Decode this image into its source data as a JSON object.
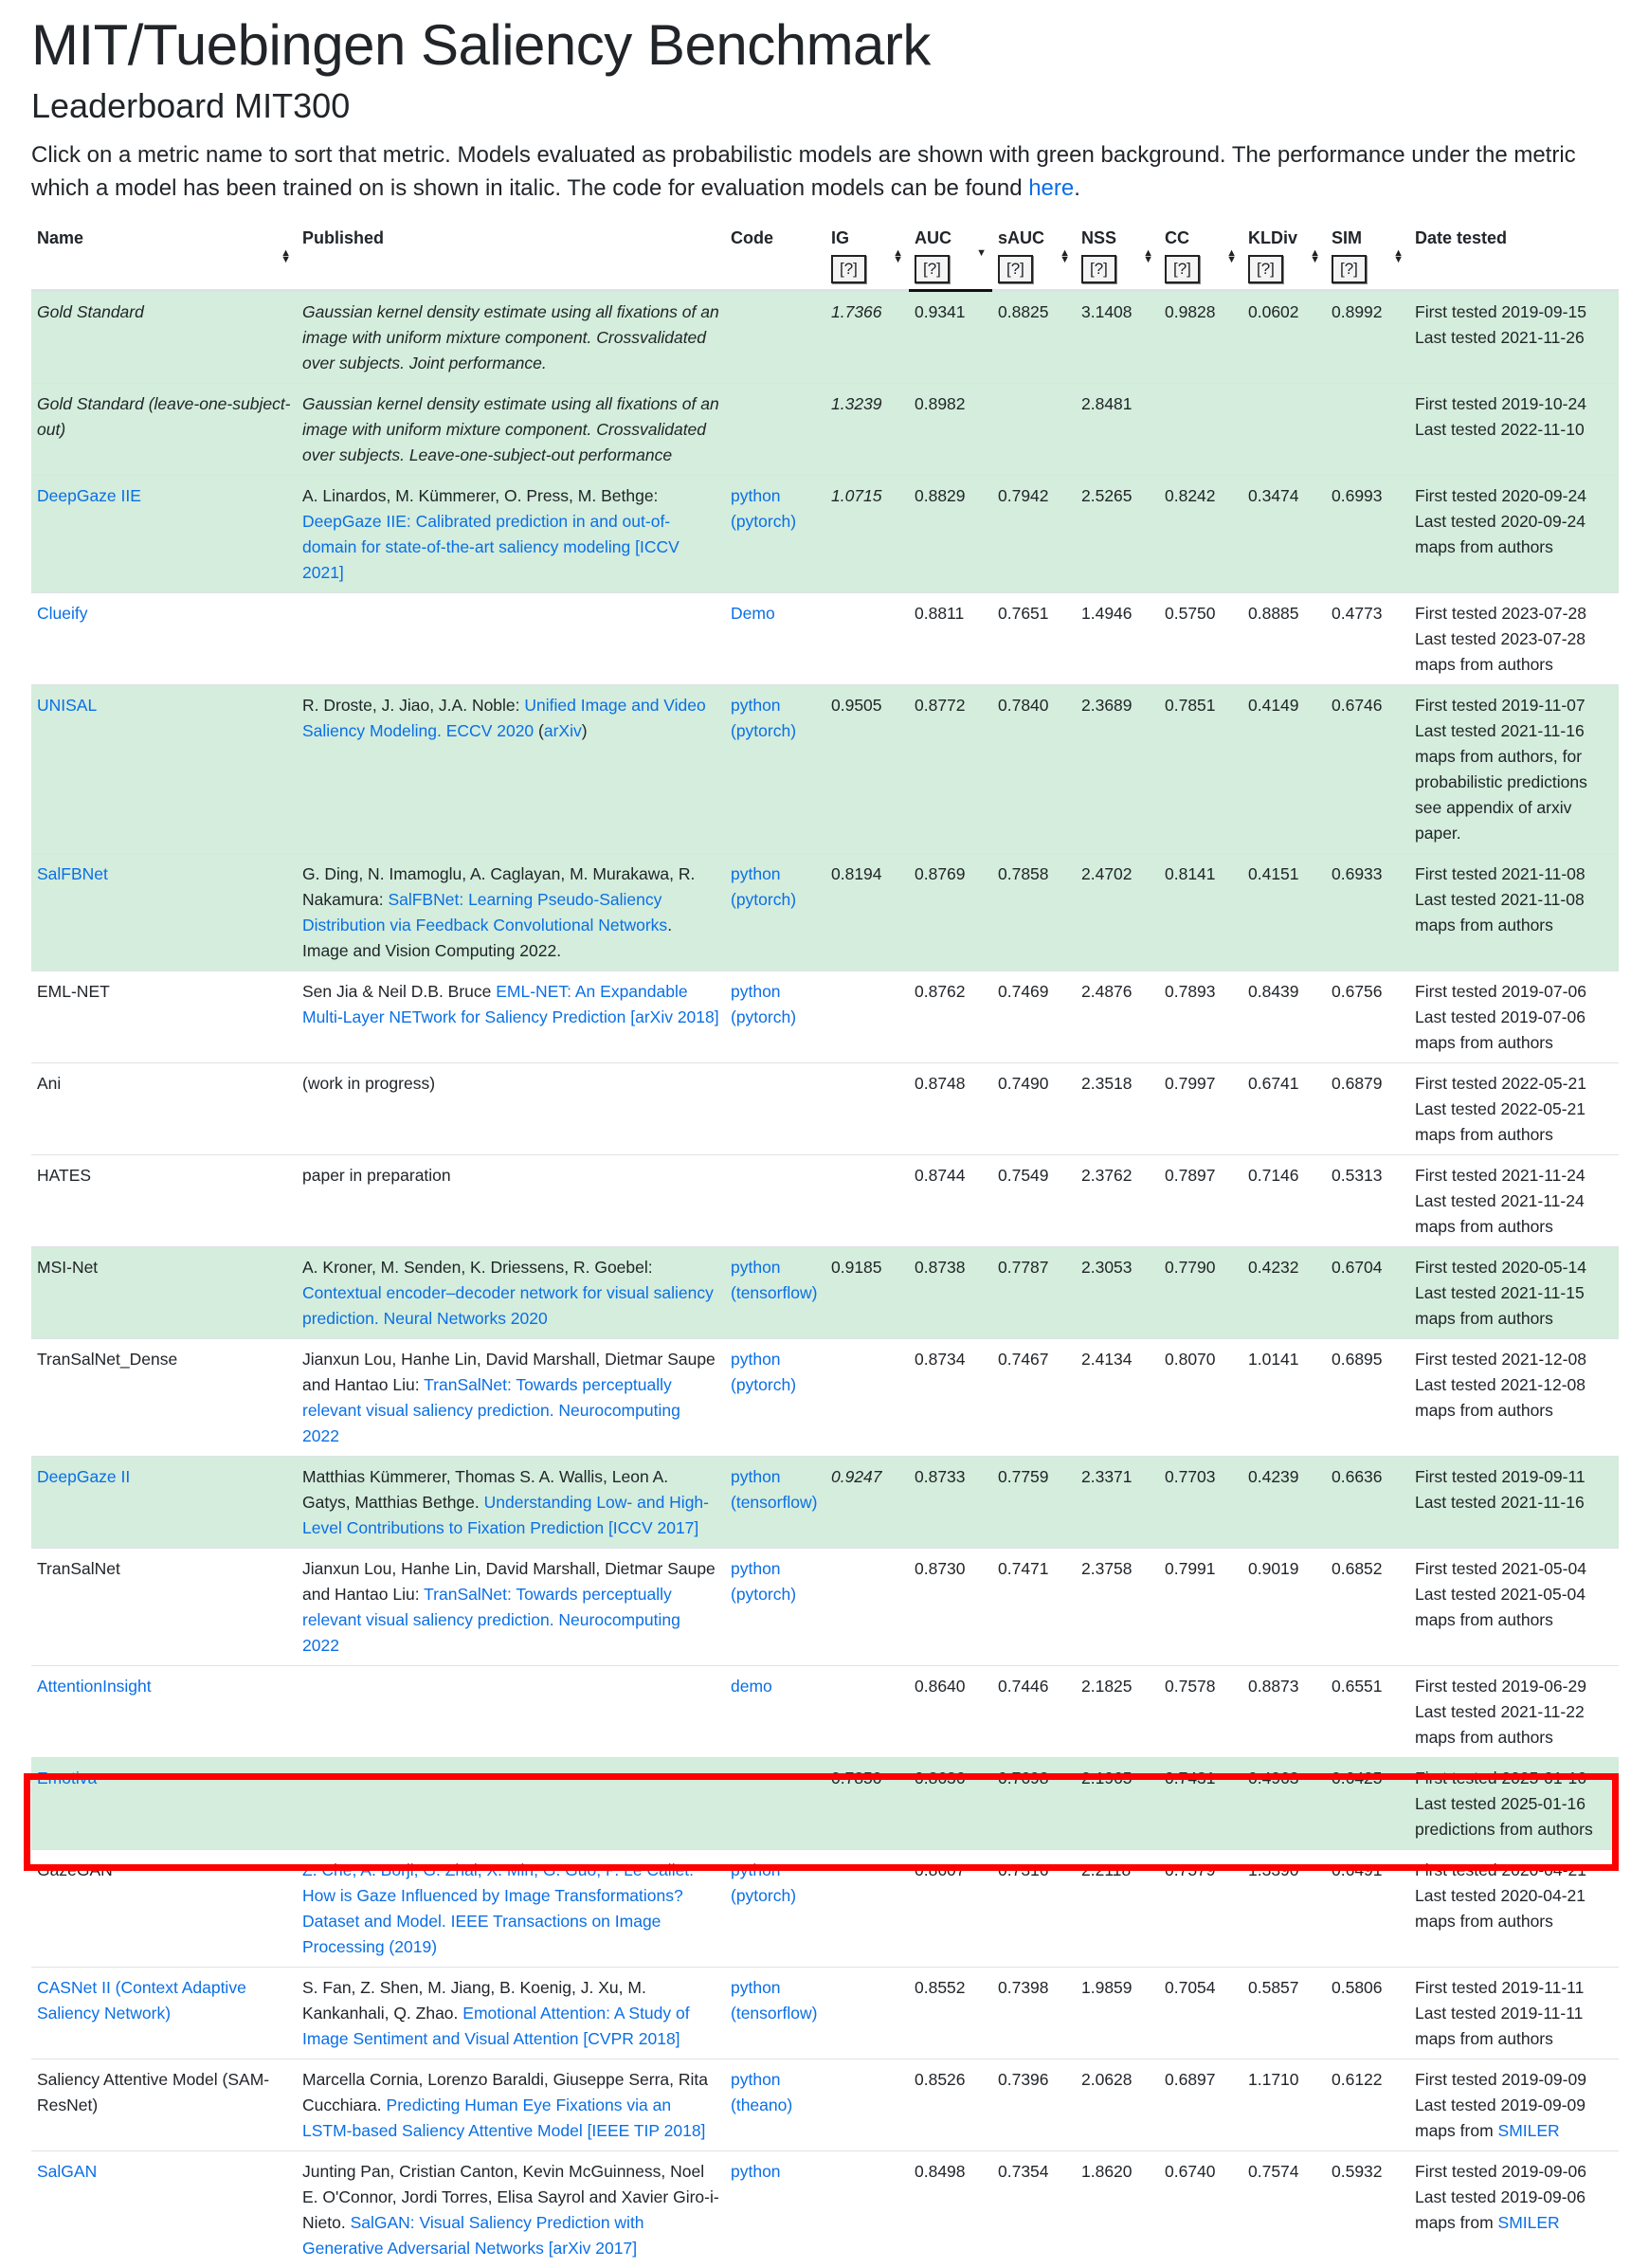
{
  "page": {
    "title": "MIT/Tuebingen Saliency Benchmark",
    "subtitle": "Leaderboard MIT300",
    "intro_text": "Click on a metric name to sort that metric. Models evaluated as probabilistic models are shown with green background. The performance under the metric which a model has been trained on is shown in italic. The code for evaluation models can be found ",
    "intro_link": "here",
    "intro_end": "."
  },
  "table": {
    "columns": [
      {
        "key": "name",
        "label": "Name",
        "help": "",
        "sort": "both"
      },
      {
        "key": "published",
        "label": "Published",
        "help": "",
        "sort": ""
      },
      {
        "key": "code",
        "label": "Code",
        "help": "",
        "sort": ""
      },
      {
        "key": "ig",
        "label": "IG",
        "help": "[?]",
        "sort": "both"
      },
      {
        "key": "auc",
        "label": "AUC",
        "help": "[?]",
        "sort": "down"
      },
      {
        "key": "sauc",
        "label": "sAUC",
        "help": "[?]",
        "sort": "both"
      },
      {
        "key": "nss",
        "label": "NSS",
        "help": "[?]",
        "sort": "both"
      },
      {
        "key": "cc",
        "label": "CC",
        "help": "[?]",
        "sort": "both"
      },
      {
        "key": "kldiv",
        "label": "KLDiv",
        "help": "[?]",
        "sort": "both"
      },
      {
        "key": "sim",
        "label": "SIM",
        "help": "[?]",
        "sort": "both"
      },
      {
        "key": "date",
        "label": "Date tested",
        "help": "",
        "sort": ""
      }
    ],
    "rows": [
      {
        "name": "Gold Standard",
        "name_link": false,
        "name_italic": true,
        "prob": true,
        "pub_plain": "Gaussian kernel density estimate using all fixations of an image with uniform mixture component. Crossvalidated over subjects. Joint performance.",
        "pub_link": "",
        "pub_after": "",
        "pub_italic": true,
        "code": [],
        "ig": "1.7366",
        "ig_italic": true,
        "auc": "0.9341",
        "sauc": "0.8825",
        "nss": "3.1408",
        "cc": "0.9828",
        "kldiv": "0.0602",
        "sim": "0.8992",
        "date": [
          "First tested 2019-09-15",
          "Last tested 2021-11-26"
        ],
        "date_link": ""
      },
      {
        "name": "Gold Standard (leave-one-subject-out)",
        "name_link": false,
        "name_italic": true,
        "prob": true,
        "pub_plain": "Gaussian kernel density estimate using all fixations of an image with uniform mixture component. Crossvalidated over subjects. Leave-one-subject-out performance",
        "pub_link": "",
        "pub_after": "",
        "pub_italic": true,
        "code": [],
        "ig": "1.3239",
        "ig_italic": true,
        "auc": "0.8982",
        "sauc": "",
        "nss": "2.8481",
        "cc": "",
        "kldiv": "",
        "sim": "",
        "date": [
          "First tested 2019-10-24",
          "Last tested 2022-11-10"
        ],
        "date_link": ""
      },
      {
        "name": "DeepGaze IIE",
        "name_link": true,
        "name_italic": false,
        "prob": true,
        "pub_plain": "A. Linardos, M. Kümmerer, O. Press, M. Bethge: ",
        "pub_link": "DeepGaze IIE: Calibrated prediction in and out-of-domain for state-of-the-art saliency modeling [ICCV 2021]",
        "pub_after": "",
        "pub_italic": false,
        "code": [
          "python",
          "(pytorch)"
        ],
        "ig": "1.0715",
        "ig_italic": true,
        "auc": "0.8829",
        "sauc": "0.7942",
        "nss": "2.5265",
        "cc": "0.8242",
        "kldiv": "0.3474",
        "sim": "0.6993",
        "date": [
          "First tested 2020-09-24",
          "Last tested 2020-09-24",
          "maps from authors"
        ],
        "date_link": ""
      },
      {
        "name": "Clueify",
        "name_link": true,
        "name_italic": false,
        "prob": false,
        "pub_plain": "",
        "pub_link": "",
        "pub_after": "",
        "pub_italic": false,
        "code": [
          "Demo"
        ],
        "ig": "",
        "ig_italic": false,
        "auc": "0.8811",
        "sauc": "0.7651",
        "nss": "1.4946",
        "cc": "0.5750",
        "kldiv": "0.8885",
        "sim": "0.4773",
        "date": [
          "First tested 2023-07-28",
          "Last tested 2023-07-28",
          "maps from authors"
        ],
        "date_link": ""
      },
      {
        "name": "UNISAL",
        "name_link": true,
        "name_italic": false,
        "prob": true,
        "pub_plain": "R. Droste, J. Jiao, J.A. Noble: ",
        "pub_link": "Unified Image and Video Saliency Modeling. ECCV 2020",
        "pub_after": " (",
        "pub_link2": "arXiv",
        "pub_after2": ")",
        "pub_italic": false,
        "code": [
          "python",
          "(pytorch)"
        ],
        "ig": "0.9505",
        "ig_italic": false,
        "auc": "0.8772",
        "sauc": "0.7840",
        "nss": "2.3689",
        "cc": "0.7851",
        "kldiv": "0.4149",
        "sim": "0.6746",
        "date": [
          "First tested 2019-11-07",
          "Last tested 2021-11-16",
          "maps from authors, for probabilistic predictions see appendix of arxiv paper."
        ],
        "date_link": ""
      },
      {
        "name": "SalFBNet",
        "name_link": true,
        "name_italic": false,
        "prob": true,
        "pub_plain": "G. Ding, N. Imamoglu, A. Caglayan, M. Murakawa, R. Nakamura: ",
        "pub_link": "SalFBNet: Learning Pseudo-Saliency Distribution via Feedback Convolutional Networks",
        "pub_after": ". Image and Vision Computing 2022.",
        "pub_italic": false,
        "code": [
          "python",
          "(pytorch)"
        ],
        "ig": "0.8194",
        "ig_italic": false,
        "auc": "0.8769",
        "sauc": "0.7858",
        "nss": "2.4702",
        "cc": "0.8141",
        "kldiv": "0.4151",
        "sim": "0.6933",
        "date": [
          "First tested 2021-11-08",
          "Last tested 2021-11-08",
          "maps from authors"
        ],
        "date_link": ""
      },
      {
        "name": "EML-NET",
        "name_link": false,
        "name_italic": false,
        "prob": false,
        "pub_plain": "Sen Jia & Neil D.B. Bruce ",
        "pub_link": "EML-NET: An Expandable Multi-Layer NETwork for Saliency Prediction [arXiv 2018]",
        "pub_after": "",
        "pub_italic": false,
        "code": [
          "python",
          "(pytorch)"
        ],
        "ig": "",
        "ig_italic": false,
        "auc": "0.8762",
        "sauc": "0.7469",
        "nss": "2.4876",
        "cc": "0.7893",
        "kldiv": "0.8439",
        "sim": "0.6756",
        "date": [
          "First tested 2019-07-06",
          "Last tested 2019-07-06",
          "maps from authors"
        ],
        "date_link": ""
      },
      {
        "name": "Ani",
        "name_link": false,
        "name_italic": false,
        "prob": false,
        "pub_plain": "(work in progress)",
        "pub_link": "",
        "pub_after": "",
        "pub_italic": false,
        "code": [],
        "ig": "",
        "ig_italic": false,
        "auc": "0.8748",
        "sauc": "0.7490",
        "nss": "2.3518",
        "cc": "0.7997",
        "kldiv": "0.6741",
        "sim": "0.6879",
        "date": [
          "First tested 2022-05-21",
          "Last tested 2022-05-21",
          "maps from authors"
        ],
        "date_link": ""
      },
      {
        "name": "HATES",
        "name_link": false,
        "name_italic": false,
        "prob": false,
        "pub_plain": "paper in preparation",
        "pub_link": "",
        "pub_after": "",
        "pub_italic": false,
        "code": [],
        "ig": "",
        "ig_italic": false,
        "auc": "0.8744",
        "sauc": "0.7549",
        "nss": "2.3762",
        "cc": "0.7897",
        "kldiv": "0.7146",
        "sim": "0.5313",
        "date": [
          "First tested 2021-11-24",
          "Last tested 2021-11-24",
          "maps from authors"
        ],
        "date_link": ""
      },
      {
        "name": "MSI-Net",
        "name_link": false,
        "name_italic": false,
        "prob": true,
        "pub_plain": "A. Kroner, M. Senden, K. Driessens, R. Goebel: ",
        "pub_link": "Contextual encoder–decoder network for visual saliency prediction. Neural Networks 2020",
        "pub_after": "",
        "pub_italic": false,
        "code": [
          "python",
          "(tensorflow)"
        ],
        "ig": "0.9185",
        "ig_italic": false,
        "auc": "0.8738",
        "sauc": "0.7787",
        "nss": "2.3053",
        "cc": "0.7790",
        "kldiv": "0.4232",
        "sim": "0.6704",
        "date": [
          "First tested 2020-05-14",
          "Last tested 2021-11-15",
          "maps from authors"
        ],
        "date_link": ""
      },
      {
        "name": "TranSalNet_Dense",
        "name_link": false,
        "name_italic": false,
        "prob": false,
        "pub_plain": "Jianxun Lou, Hanhe Lin, David Marshall, Dietmar Saupe and Hantao Liu: ",
        "pub_link": "TranSalNet: Towards perceptually relevant visual saliency prediction. Neurocomputing 2022",
        "pub_after": "",
        "pub_italic": false,
        "code": [
          "python",
          "(pytorch)"
        ],
        "ig": "",
        "ig_italic": false,
        "auc": "0.8734",
        "sauc": "0.7467",
        "nss": "2.4134",
        "cc": "0.8070",
        "kldiv": "1.0141",
        "sim": "0.6895",
        "date": [
          "First tested 2021-12-08",
          "Last tested 2021-12-08",
          "maps from authors"
        ],
        "date_link": ""
      },
      {
        "name": "DeepGaze II",
        "name_link": true,
        "name_italic": false,
        "prob": true,
        "pub_plain": "Matthias Kümmerer, Thomas S. A. Wallis, Leon A. Gatys, Matthias Bethge. ",
        "pub_link": "Understanding Low- and High-Level Contributions to Fixation Prediction [ICCV 2017]",
        "pub_after": "",
        "pub_italic": false,
        "code": [
          "python",
          "(tensorflow)"
        ],
        "ig": "0.9247",
        "ig_italic": true,
        "auc": "0.8733",
        "sauc": "0.7759",
        "nss": "2.3371",
        "cc": "0.7703",
        "kldiv": "0.4239",
        "sim": "0.6636",
        "date": [
          "First tested 2019-09-11",
          "Last tested 2021-11-16"
        ],
        "date_link": ""
      },
      {
        "name": "TranSalNet",
        "name_link": false,
        "name_italic": false,
        "prob": false,
        "pub_plain": "Jianxun Lou, Hanhe Lin, David Marshall, Dietmar Saupe and Hantao Liu: ",
        "pub_link": "TranSalNet: Towards perceptually relevant visual saliency prediction. Neurocomputing 2022",
        "pub_after": "",
        "pub_italic": false,
        "code": [
          "python",
          "(pytorch)"
        ],
        "ig": "",
        "ig_italic": false,
        "auc": "0.8730",
        "sauc": "0.7471",
        "nss": "2.3758",
        "cc": "0.7991",
        "kldiv": "0.9019",
        "sim": "0.6852",
        "date": [
          "First tested 2021-05-04",
          "Last tested 2021-05-04",
          "maps from authors"
        ],
        "date_link": ""
      },
      {
        "name": "AttentionInsight",
        "name_link": true,
        "name_italic": false,
        "prob": false,
        "pub_plain": "",
        "pub_link": "",
        "pub_after": "",
        "pub_italic": false,
        "code": [
          "demo"
        ],
        "ig": "",
        "ig_italic": false,
        "auc": "0.8640",
        "sauc": "0.7446",
        "nss": "2.1825",
        "cc": "0.7578",
        "kldiv": "0.8873",
        "sim": "0.6551",
        "date": [
          "First tested 2019-06-29",
          "Last tested 2021-11-22",
          "maps from authors"
        ],
        "date_link": ""
      },
      {
        "name": "Emotiva",
        "name_link": true,
        "name_italic": false,
        "prob": true,
        "highlight": true,
        "pub_plain": "",
        "pub_link": "",
        "pub_after": "",
        "pub_italic": false,
        "code": [],
        "ig": "0.7850",
        "ig_italic": false,
        "auc": "0.8636",
        "sauc": "0.7698",
        "nss": "2.1965",
        "cc": "0.7431",
        "kldiv": "0.4963",
        "sim": "0.6425",
        "date": [
          "First tested 2025-01-16",
          "Last tested 2025-01-16",
          "predictions from authors"
        ],
        "date_link": ""
      },
      {
        "name": "GazeGAN",
        "name_link": false,
        "name_italic": false,
        "prob": false,
        "pub_plain": "",
        "pub_link": "Z. Che, A. Borji, G. Zhai, X. Min, G. Guo, P. Le Callet: How is Gaze Influenced by Image Transformations? Dataset and Model. IEEE Transactions on Image Processing (2019)",
        "pub_after": "",
        "pub_italic": false,
        "code": [
          "python",
          "(pytorch)"
        ],
        "ig": "",
        "ig_italic": false,
        "auc": "0.8607",
        "sauc": "0.7316",
        "nss": "2.2118",
        "cc": "0.7579",
        "kldiv": "1.3390",
        "sim": "0.6491",
        "date": [
          "First tested 2020-04-21",
          "Last tested 2020-04-21",
          "maps from authors"
        ],
        "date_link": ""
      },
      {
        "name": "CASNet II (Context Adaptive Saliency Network)",
        "name_link": true,
        "name_italic": false,
        "prob": false,
        "pub_plain": "S. Fan, Z. Shen, M. Jiang, B. Koenig, J. Xu, M. Kankanhali, Q. Zhao. ",
        "pub_link": "Emotional Attention: A Study of Image Sentiment and Visual Attention [CVPR 2018]",
        "pub_after": "",
        "pub_italic": false,
        "code": [
          "python",
          "(tensorflow)"
        ],
        "ig": "",
        "ig_italic": false,
        "auc": "0.8552",
        "sauc": "0.7398",
        "nss": "1.9859",
        "cc": "0.7054",
        "kldiv": "0.5857",
        "sim": "0.5806",
        "date": [
          "First tested 2019-11-11",
          "Last tested 2019-11-11",
          "maps from authors"
        ],
        "date_link": ""
      },
      {
        "name": "Saliency Attentive Model (SAM-ResNet)",
        "name_link": false,
        "name_italic": false,
        "prob": false,
        "pub_plain": "Marcella Cornia, Lorenzo Baraldi, Giuseppe Serra, Rita Cucchiara. ",
        "pub_link": "Predicting Human Eye Fixations via an LSTM-based Saliency Attentive Model [IEEE TIP 2018]",
        "pub_after": "",
        "pub_italic": false,
        "code": [
          "python",
          "(theano)"
        ],
        "ig": "",
        "ig_italic": false,
        "auc": "0.8526",
        "sauc": "0.7396",
        "nss": "2.0628",
        "cc": "0.6897",
        "kldiv": "1.1710",
        "sim": "0.6122",
        "date": [
          "First tested 2019-09-09",
          "Last tested 2019-09-09",
          "maps from "
        ],
        "date_link": "SMILER"
      },
      {
        "name": "SalGAN",
        "name_link": true,
        "name_italic": false,
        "prob": false,
        "pub_plain": "Junting Pan, Cristian Canton, Kevin McGuinness, Noel E. O'Connor, Jordi Torres, Elisa Sayrol and Xavier Giro-i-Nieto. ",
        "pub_link": "SalGAN: Visual Saliency Prediction with Generative Adversarial Networks [arXiv 2017]",
        "pub_after": "",
        "pub_italic": false,
        "code": [
          "python"
        ],
        "ig": "",
        "ig_italic": false,
        "auc": "0.8498",
        "sauc": "0.7354",
        "nss": "1.8620",
        "cc": "0.6740",
        "kldiv": "0.7574",
        "sim": "0.5932",
        "date": [
          "First tested 2019-09-06",
          "Last tested 2019-09-06",
          "maps from "
        ],
        "date_link": "SMILER"
      }
    ]
  },
  "colors": {
    "probabilistic_bg": "#d4eddc",
    "link": "#0a6fe6",
    "highlight_border": "#ff0000"
  }
}
